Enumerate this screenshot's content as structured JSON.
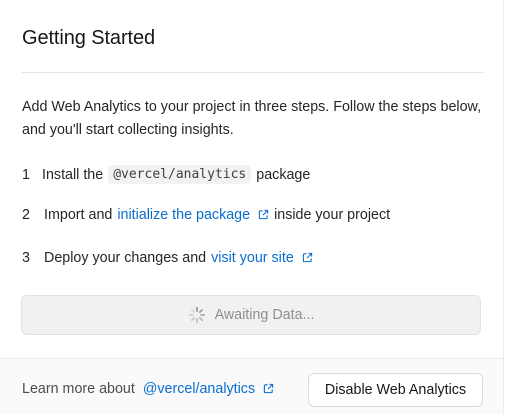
{
  "card": {
    "title": "Getting Started",
    "intro": "Add Web Analytics to your project in three steps. Follow the steps below, and you'll start collecting insights."
  },
  "steps": [
    {
      "number": "1",
      "before": "Install the",
      "code": "@vercel/analytics",
      "after": "package"
    },
    {
      "number": "2",
      "before": "Import and",
      "link": "initialize the package",
      "after": "inside your project"
    },
    {
      "number": "3",
      "before": "Deploy your changes and",
      "link": "visit your site"
    }
  ],
  "status": {
    "label": "Awaiting Data..."
  },
  "footer": {
    "learn_prefix": "Learn more about",
    "learn_link": "@vercel/analytics",
    "disable_button": "Disable Web Analytics"
  },
  "colors": {
    "link": "#0a6ed1",
    "status_text": "#8f8f8f",
    "status_bg": "#f1f1f1"
  },
  "icons": {
    "external_link": "external-link-icon",
    "spinner": "spinner-icon"
  }
}
